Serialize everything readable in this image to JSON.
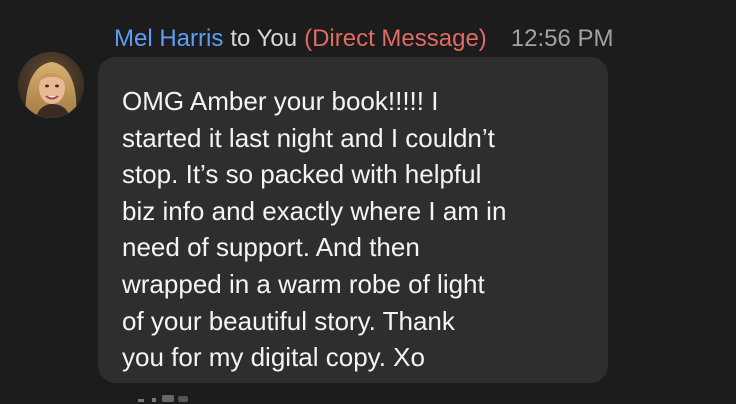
{
  "message": {
    "sender_name": "Mel Harris",
    "recipient_text": "to You",
    "dm_label": "(Direct Message)",
    "timestamp": "12:56 PM",
    "body": "OMG Amber your book!!!!! I\nstarted it last night and I couldn’t\nstop.  It’s so packed with helpful\nbiz info and exactly where I am in\nneed of support.  And then\nwrapped in a warm robe of light\nof your beautiful story.  Thank\nyou for my digital copy. Xo"
  },
  "colors": {
    "background": "#1c1c1c",
    "bubble": "#2e2e2e",
    "sender": "#5d9df5",
    "dm_label": "#e16a63",
    "timestamp": "#a2a2a2",
    "text": "#f4f4f4"
  },
  "icons": {
    "avatar": "sender-avatar-photo"
  }
}
